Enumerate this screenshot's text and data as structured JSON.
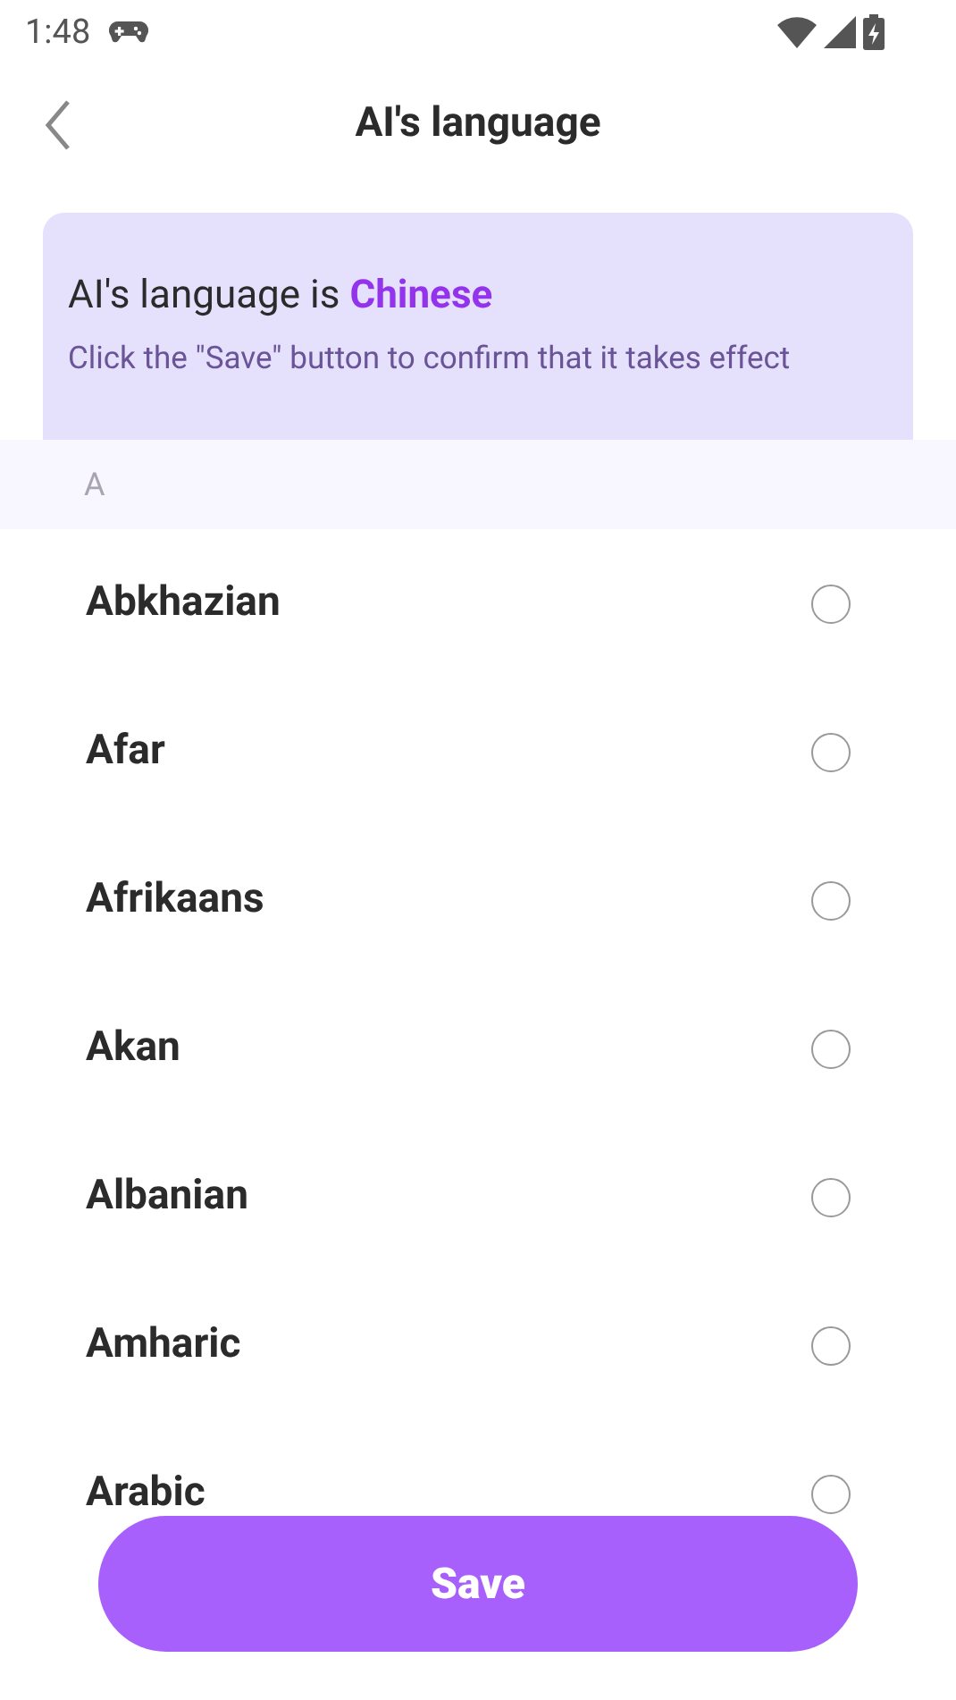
{
  "status_bar": {
    "time": "1:48"
  },
  "header": {
    "title": "AI's language"
  },
  "info_card": {
    "current": "AI's language is **Chinese**",
    "hint": "Click the \"Save\" button to confirm that it takes effect"
  },
  "section": {
    "letter": "A"
  },
  "languages": [
    {
      "name": "Abkhazian",
      "selected": false
    },
    {
      "name": "Afar",
      "selected": false
    },
    {
      "name": "Afrikaans",
      "selected": false
    },
    {
      "name": "Akan",
      "selected": false
    },
    {
      "name": "Albanian",
      "selected": false
    },
    {
      "name": "Amharic",
      "selected": false
    },
    {
      "name": "Arabic",
      "selected": false
    }
  ],
  "save_button": {
    "label": "Save"
  }
}
